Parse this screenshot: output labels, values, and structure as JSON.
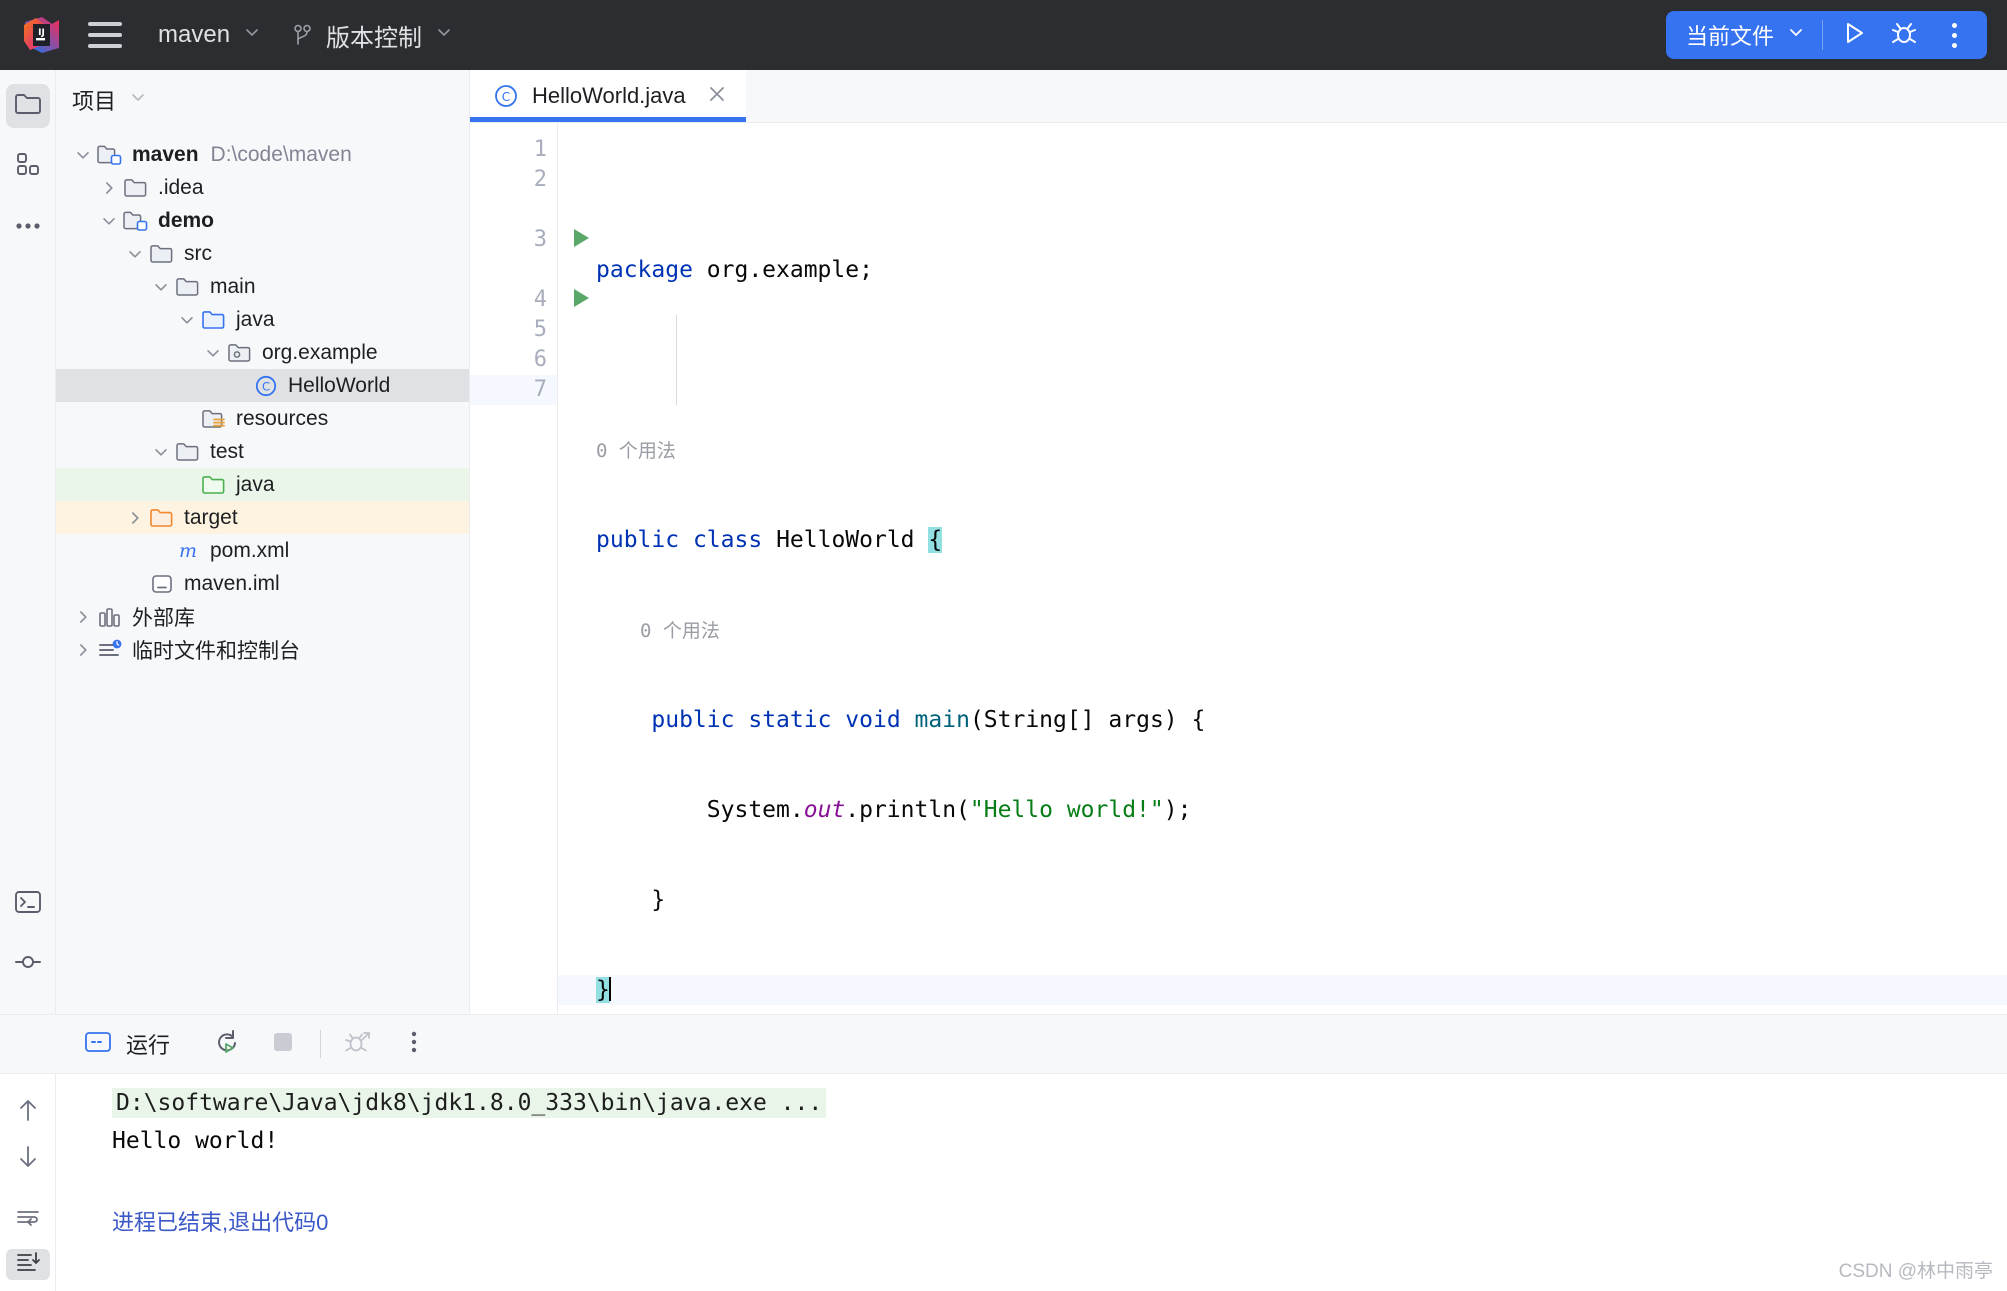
{
  "titlebar": {
    "logo_name": "intellij-idea-logo",
    "menu_icon": "hamburger-menu-icon",
    "project_name": "maven",
    "vcs_label": "版本控制",
    "run_config": "当前文件",
    "run_icon": "run-play-icon",
    "debug_icon": "debug-bug-icon",
    "more_icon": "more-vertical-icon"
  },
  "tool_strip": {
    "project_icon": "folder-icon",
    "structure_icon": "structure-blocks-icon",
    "more_icon": "more-horizontal-icon",
    "terminal_icon": "terminal-icon",
    "commit_icon": "commit-icon"
  },
  "project_panel": {
    "title": "项目",
    "chevron": "chevron-down-icon",
    "tree": [
      {
        "label": "maven",
        "sub": "D:\\code\\maven",
        "depth": 0,
        "twisty": "down",
        "icon": "module-folder-icon",
        "bold": true,
        "state": "normal"
      },
      {
        "label": ".idea",
        "sub": "",
        "depth": 1,
        "twisty": "right",
        "icon": "folder-icon",
        "bold": false,
        "state": "normal"
      },
      {
        "label": "demo",
        "sub": "",
        "depth": 1,
        "twisty": "down",
        "icon": "module-folder-icon",
        "bold": true,
        "state": "normal"
      },
      {
        "label": "src",
        "sub": "",
        "depth": 2,
        "twisty": "down",
        "icon": "folder-icon",
        "bold": false,
        "state": "normal"
      },
      {
        "label": "main",
        "sub": "",
        "depth": 3,
        "twisty": "down",
        "icon": "folder-icon",
        "bold": false,
        "state": "normal"
      },
      {
        "label": "java",
        "sub": "",
        "depth": 4,
        "twisty": "down",
        "icon": "source-root-folder-icon",
        "bold": false,
        "state": "normal"
      },
      {
        "label": "org.example",
        "sub": "",
        "depth": 5,
        "twisty": "down",
        "icon": "package-icon",
        "bold": false,
        "state": "normal"
      },
      {
        "label": "HelloWorld",
        "sub": "",
        "depth": 6,
        "twisty": "none",
        "icon": "java-class-icon",
        "bold": false,
        "state": "selected"
      },
      {
        "label": "resources",
        "sub": "",
        "depth": 4,
        "twisty": "none",
        "icon": "resources-folder-icon",
        "bold": false,
        "state": "normal"
      },
      {
        "label": "test",
        "sub": "",
        "depth": 3,
        "twisty": "down",
        "icon": "folder-icon",
        "bold": false,
        "state": "normal"
      },
      {
        "label": "java",
        "sub": "",
        "depth": 4,
        "twisty": "none",
        "icon": "test-source-folder-icon",
        "bold": false,
        "state": "green"
      },
      {
        "label": "target",
        "sub": "",
        "depth": 2,
        "twisty": "right",
        "icon": "excluded-folder-icon",
        "bold": false,
        "state": "orange"
      },
      {
        "label": "pom.xml",
        "sub": "",
        "depth": 3,
        "twisty": "none",
        "icon": "maven-pom-icon",
        "bold": false,
        "state": "normal"
      },
      {
        "label": "maven.iml",
        "sub": "",
        "depth": 2,
        "twisty": "none",
        "icon": "iml-file-icon",
        "bold": false,
        "state": "normal"
      },
      {
        "label": "外部库",
        "sub": "",
        "depth": 0,
        "twisty": "right",
        "icon": "external-libraries-icon",
        "bold": false,
        "state": "normal"
      },
      {
        "label": "临时文件和控制台",
        "sub": "",
        "depth": 0,
        "twisty": "right",
        "icon": "scratches-consoles-icon",
        "bold": false,
        "state": "normal"
      }
    ]
  },
  "editor": {
    "tab": {
      "label": "HelloWorld.java",
      "icon": "java-class-icon",
      "close_icon": "close-icon"
    },
    "lines": [
      {
        "num": "1",
        "run_marker": false,
        "caret": false
      },
      {
        "num": "2",
        "run_marker": false,
        "caret": false
      },
      {
        "num": "3",
        "run_marker": true,
        "caret": false
      },
      {
        "num": "4",
        "run_marker": true,
        "caret": false
      },
      {
        "num": "5",
        "run_marker": false,
        "caret": false
      },
      {
        "num": "6",
        "run_marker": false,
        "caret": false
      },
      {
        "num": "7",
        "run_marker": false,
        "caret": true
      }
    ],
    "code": {
      "l1_kw": "package",
      "l1_rest": " org.example;",
      "hint_class": "0 个用法",
      "l3_kw1": "public",
      "l3_kw2": "class",
      "l3_name": "HelloWorld",
      "l3_brace": "{",
      "hint_method": "0 个用法",
      "l4_kw1": "public",
      "l4_kw2": "static",
      "l4_kw3": "void",
      "l4_name": "main",
      "l4_rest": "(String[] args) {",
      "l5_indent": "        ",
      "l5_system": "System.",
      "l5_out": "out",
      "l5_println": ".println(",
      "l5_str": "\"Hello world!\"",
      "l5_end": ");",
      "l6": "    }",
      "l7": "}"
    }
  },
  "run_panel": {
    "title": "运行",
    "window_icon": "run-tool-window-icon",
    "rerun_icon": "rerun-icon",
    "stop_icon": "stop-icon",
    "debug_icon": "debug-bug-icon",
    "more_icon": "more-vertical-icon",
    "gutter": {
      "up_icon": "arrow-up-icon",
      "down_icon": "arrow-down-icon",
      "soft_wrap_icon": "soft-wrap-icon",
      "scroll_end_icon": "scroll-to-end-icon"
    },
    "console": {
      "command": "D:\\software\\Java\\jdk8\\jdk1.8.0_333\\bin\\java.exe ...",
      "output": "Hello world!",
      "exit": "进程已结束,退出代码0"
    }
  },
  "watermark": "CSDN @林中雨亭",
  "colors": {
    "accent_blue": "#3573f0",
    "titlebar_bg": "#2b2d30",
    "panel_bg": "#f7f8fa",
    "selection": "#dfe1e5",
    "green_row": "#eaf6ea",
    "orange_row": "#fdf3e0",
    "keyword": "#0033b3",
    "string": "#067d17",
    "static_field": "#871094",
    "method": "#00627a",
    "brace_match": "#93e0e3",
    "console_cmd_bg": "#e9f5e9",
    "exit_text": "#3b58c7"
  }
}
